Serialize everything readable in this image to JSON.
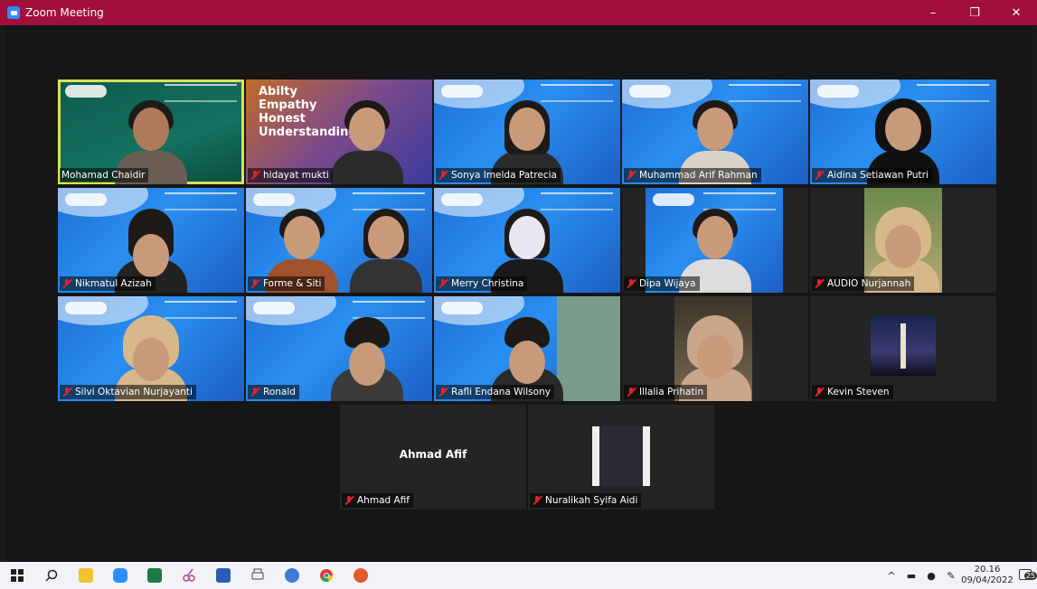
{
  "window": {
    "title": "Zoom Meeting",
    "minimize_glyph": "–",
    "restore_glyph": "❐",
    "close_glyph": "✕"
  },
  "participants": [
    {
      "name": "Mohamad Chaidir",
      "muted": false,
      "active": true
    },
    {
      "name": "hidayat mukti",
      "muted": true
    },
    {
      "name": "Sonya Imelda Patrecia",
      "muted": true
    },
    {
      "name": "Muhammad Arif Rahman",
      "muted": true
    },
    {
      "name": "Aidina Setiawan Putri",
      "muted": true
    },
    {
      "name": "Nikmatul Azizah",
      "muted": true
    },
    {
      "name": "Forme & Siti",
      "muted": true
    },
    {
      "name": "Merry Christina",
      "muted": true
    },
    {
      "name": "Dipa Wijaya",
      "muted": true
    },
    {
      "name": "AUDIO Nurjannah",
      "muted": true
    },
    {
      "name": "Silvi Oktavian Nurjayanti",
      "muted": true
    },
    {
      "name": "Ronald",
      "muted": true
    },
    {
      "name": "Rafli Endana Wilsony",
      "muted": true
    },
    {
      "name": "Illalia Prihatin",
      "muted": true
    },
    {
      "name": "Kevin Steven",
      "muted": true
    },
    {
      "name": "Ahmad Afif",
      "muted": true,
      "video_off": true,
      "center_label": "Ahmad Afif"
    },
    {
      "name": "Nuralikah Syifa Aidi",
      "muted": true
    }
  ],
  "tile2_text": {
    "line1": "Abilty",
    "line2": "Empathy",
    "line3": "Honest",
    "line4": "Understanding"
  },
  "taskbar": {
    "icons": [
      "windows-start-icon",
      "search-icon",
      "file-explorer-icon",
      "zoom-icon",
      "excel-icon",
      "snipping-tool-icon",
      "word-icon",
      "printer-icon",
      "browser-icon",
      "chrome-icon",
      "app-icon"
    ],
    "time": "20.16",
    "date": "09/04/2022",
    "notification_count": "25",
    "tray_up_glyph": "^"
  }
}
